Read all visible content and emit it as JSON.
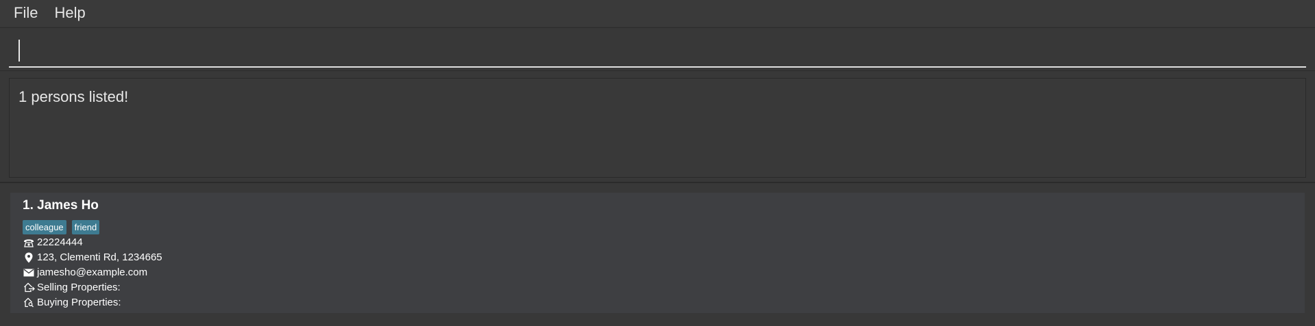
{
  "menu": {
    "file": "File",
    "help": "Help"
  },
  "command": {
    "value": "",
    "placeholder": ""
  },
  "result": {
    "message": "1 persons listed!"
  },
  "persons": [
    {
      "index_name": "1. James Ho",
      "tags": [
        "colleague",
        "friend"
      ],
      "phone": "22224444",
      "address": "123, Clementi Rd, 1234665",
      "email": "jamesho@example.com",
      "selling": "Selling Properties:",
      "buying": "Buying Properties:"
    }
  ],
  "colors": {
    "background": "#383838",
    "card": "#3e3f42",
    "tag": "#3e7b91",
    "text": "#ffffff"
  },
  "icons": {
    "phone": "phone-icon",
    "address": "location-pin-icon",
    "email": "mail-icon",
    "selling": "house-out-icon",
    "buying": "house-search-icon"
  }
}
